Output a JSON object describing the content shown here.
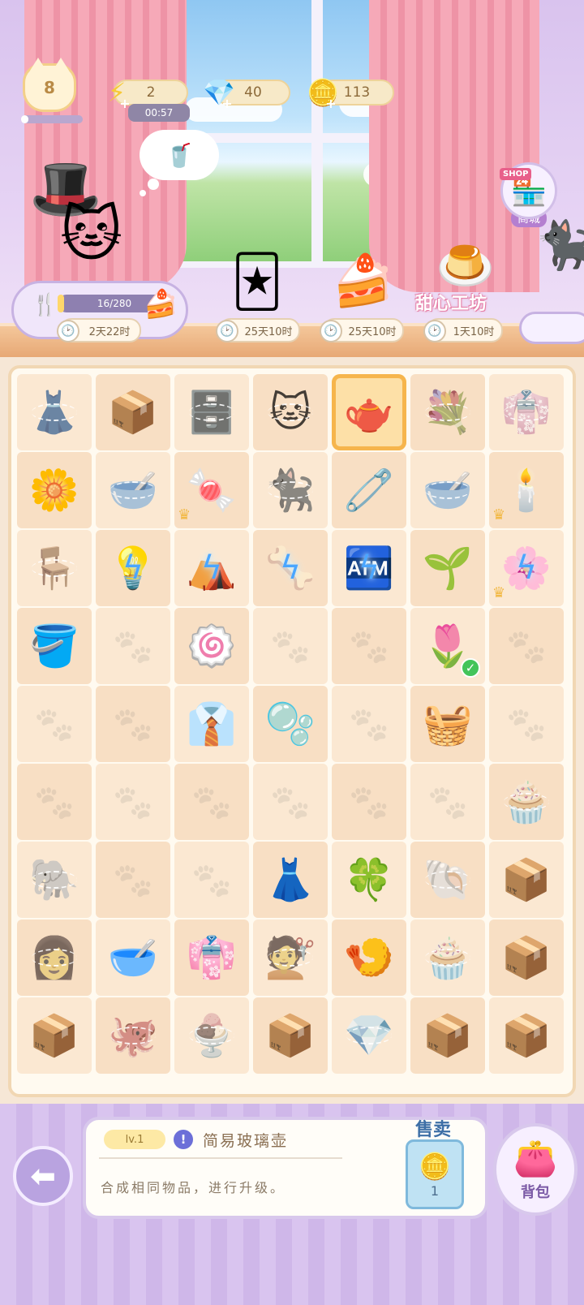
{
  "hud": {
    "level": "8",
    "energy": "2",
    "energy_timer": "00:57",
    "gems": "40",
    "coins": "113",
    "xp_fraction": 0.12,
    "energy_icon": "lightning-bolt",
    "gem_icon": "pink-diamond",
    "coin_icon": "gold-coin"
  },
  "scene": {
    "thought_item": "iced-drink",
    "order_progress": "16/280",
    "order_progress_fraction": 0.057,
    "order_timer": "2天22时",
    "events": [
      {
        "name": "card-pack-event",
        "timer": "25天10时"
      },
      {
        "name": "strawberry-roll-cake-event",
        "timer": "25天10时"
      },
      {
        "name": "sweet-workshop-event",
        "timer": "1天10时",
        "title": "甜心工坊"
      }
    ],
    "shop_tag": "SHOP",
    "shop_label": "商城"
  },
  "board": {
    "rows": [
      [
        {
          "name": "dark-dress",
          "emoji": "👗",
          "web": true
        },
        {
          "name": "cardboard-box",
          "emoji": "📦"
        },
        {
          "name": "display-cabinet",
          "emoji": "🗄️",
          "web": true
        },
        {
          "name": "calico-cat",
          "emoji": "🐱",
          "web": true
        },
        {
          "name": "glass-pitcher",
          "emoji": "🫖",
          "selected": true
        },
        {
          "name": "purple-flower-bouquet",
          "emoji": "💐",
          "web": true
        },
        {
          "name": "clothing-rack",
          "emoji": "👘",
          "web": true
        }
      ],
      [
        {
          "name": "yellow-flower-bouquet",
          "emoji": "🌼"
        },
        {
          "name": "brown-pet-bowl",
          "emoji": "🥣",
          "web": true
        },
        {
          "name": "snack-bag",
          "emoji": "🍬",
          "crown": true
        },
        {
          "name": "grey-cat",
          "emoji": "🐈‍⬛",
          "web": true
        },
        {
          "name": "pink-hanger",
          "emoji": "🧷"
        },
        {
          "name": "teal-pet-bowl",
          "emoji": "🥣",
          "web": true
        },
        {
          "name": "candelabra",
          "emoji": "🕯️",
          "crown": true
        }
      ],
      [
        {
          "name": "orange-side-table",
          "emoji": "🪑",
          "web": true
        },
        {
          "name": "lamp",
          "emoji": "💡",
          "bolt": true
        },
        {
          "name": "cat-tent",
          "emoji": "⛺",
          "bolt": true
        },
        {
          "name": "bone-toy",
          "emoji": "🦴",
          "bolt": true
        },
        {
          "name": "vending-machine",
          "emoji": "🏧",
          "bolt": true
        },
        {
          "name": "sprout",
          "emoji": "🌱"
        },
        {
          "name": "flower-box",
          "emoji": "🌸",
          "bolt": true,
          "crown": true
        }
      ],
      [
        {
          "name": "watering-can",
          "emoji": "🪣"
        },
        {
          "name": "empty"
        },
        {
          "name": "pink-pet-bowl",
          "emoji": "🍥"
        },
        {
          "name": "empty"
        },
        {
          "name": "empty"
        },
        {
          "name": "tulip",
          "emoji": "🌷",
          "check": true
        },
        {
          "name": "empty"
        }
      ],
      [
        {
          "name": "empty"
        },
        {
          "name": "empty"
        },
        {
          "name": "striped-outfit",
          "emoji": "👔"
        },
        {
          "name": "pink-cushion",
          "emoji": "🫧"
        },
        {
          "name": "empty"
        },
        {
          "name": "fruit-basket",
          "emoji": "🧺"
        },
        {
          "name": "empty"
        }
      ],
      [
        {
          "name": "empty"
        },
        {
          "name": "empty"
        },
        {
          "name": "empty"
        },
        {
          "name": "empty"
        },
        {
          "name": "empty"
        },
        {
          "name": "empty"
        },
        {
          "name": "strawberry-cupcake",
          "emoji": "🧁",
          "web": true
        }
      ],
      [
        {
          "name": "elephant-plush",
          "emoji": "🐘",
          "web": true
        },
        {
          "name": "empty"
        },
        {
          "name": "empty"
        },
        {
          "name": "pink-dress",
          "emoji": "👗"
        },
        {
          "name": "green-clover-cushion",
          "emoji": "🍀"
        },
        {
          "name": "shell-cushion",
          "emoji": "🐚",
          "web": true
        },
        {
          "name": "cardboard-box",
          "emoji": "📦"
        }
      ],
      [
        {
          "name": "hair-bun-wig",
          "emoji": "👩",
          "web": true
        },
        {
          "name": "lavender-pet-bowl",
          "emoji": "🥣"
        },
        {
          "name": "yellow-outfit",
          "emoji": "👘"
        },
        {
          "name": "hair-wig",
          "emoji": "💇",
          "web": true
        },
        {
          "name": "fish-snack-plate",
          "emoji": "🍤"
        },
        {
          "name": "cat-cupcake",
          "emoji": "🧁",
          "web": true
        },
        {
          "name": "cardboard-box",
          "emoji": "📦"
        }
      ],
      [
        {
          "name": "cardboard-box",
          "emoji": "📦"
        },
        {
          "name": "octopus-plush",
          "emoji": "🐙",
          "web": true
        },
        {
          "name": "berry-parfait",
          "emoji": "🍨",
          "web": true
        },
        {
          "name": "cardboard-box",
          "emoji": "📦"
        },
        {
          "name": "earrings",
          "emoji": "💎",
          "web": true
        },
        {
          "name": "cardboard-box",
          "emoji": "📦"
        },
        {
          "name": "cardboard-box",
          "emoji": "📦"
        }
      ]
    ]
  },
  "info": {
    "level": "lv.1",
    "item_name": "简易玻璃壶",
    "description": "合成相同物品，进行升级。",
    "sell_label": "售卖",
    "sell_price": "1",
    "bag_label": "背包"
  },
  "colors": {
    "accent": "#f6b54c",
    "panel_border": "#d8c8ec",
    "board_bg": "#fbe8d2"
  }
}
